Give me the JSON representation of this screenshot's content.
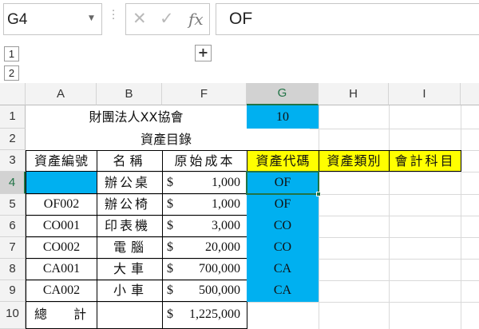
{
  "name_box": {
    "value": "G4"
  },
  "formula_bar": {
    "cancel_icon": "close-icon",
    "enter_icon": "check-icon",
    "function_label": "fx",
    "value": "OF"
  },
  "outline": {
    "levels": [
      "1",
      "2"
    ],
    "expand_label": "+"
  },
  "columns": [
    "A",
    "B",
    "F",
    "G",
    "H",
    "I"
  ],
  "selected_column": "G",
  "rows": [
    "1",
    "2",
    "3",
    "4",
    "5",
    "6",
    "7",
    "8",
    "9",
    "10"
  ],
  "selected_row": "4",
  "colors": {
    "code_fill": "#00b0f0",
    "header_fill": "#ffff00",
    "selection_border": "#217346"
  },
  "sheet": {
    "r1": {
      "title": "財團法人XX協會",
      "g": "10"
    },
    "r2": {
      "subtitle": "資產目錄"
    },
    "r3": {
      "a": "資產編號",
      "b": "名稱",
      "f": "原始成本",
      "g": "資產代碼",
      "h": "資產類別",
      "i": "會計科目"
    },
    "items": [
      {
        "a": "",
        "b": "辦公桌",
        "cur": "$",
        "f": "1,000",
        "g": "OF"
      },
      {
        "a": "OF002",
        "b": "辦公椅",
        "cur": "$",
        "f": "1,000",
        "g": "OF"
      },
      {
        "a": "CO001",
        "b": "印表機",
        "cur": "$",
        "f": "3,000",
        "g": "CO"
      },
      {
        "a": "CO002",
        "b": "電腦",
        "cur": "$",
        "f": "20,000",
        "g": "CO"
      },
      {
        "a": "CA001",
        "b": "大車",
        "cur": "$",
        "f": "700,000",
        "g": "CA"
      },
      {
        "a": "CA002",
        "b": "小車",
        "cur": "$",
        "f": "500,000",
        "g": "CA"
      }
    ],
    "r10": {
      "a": "總　 計",
      "cur": "$",
      "f": "1,225,000"
    }
  }
}
